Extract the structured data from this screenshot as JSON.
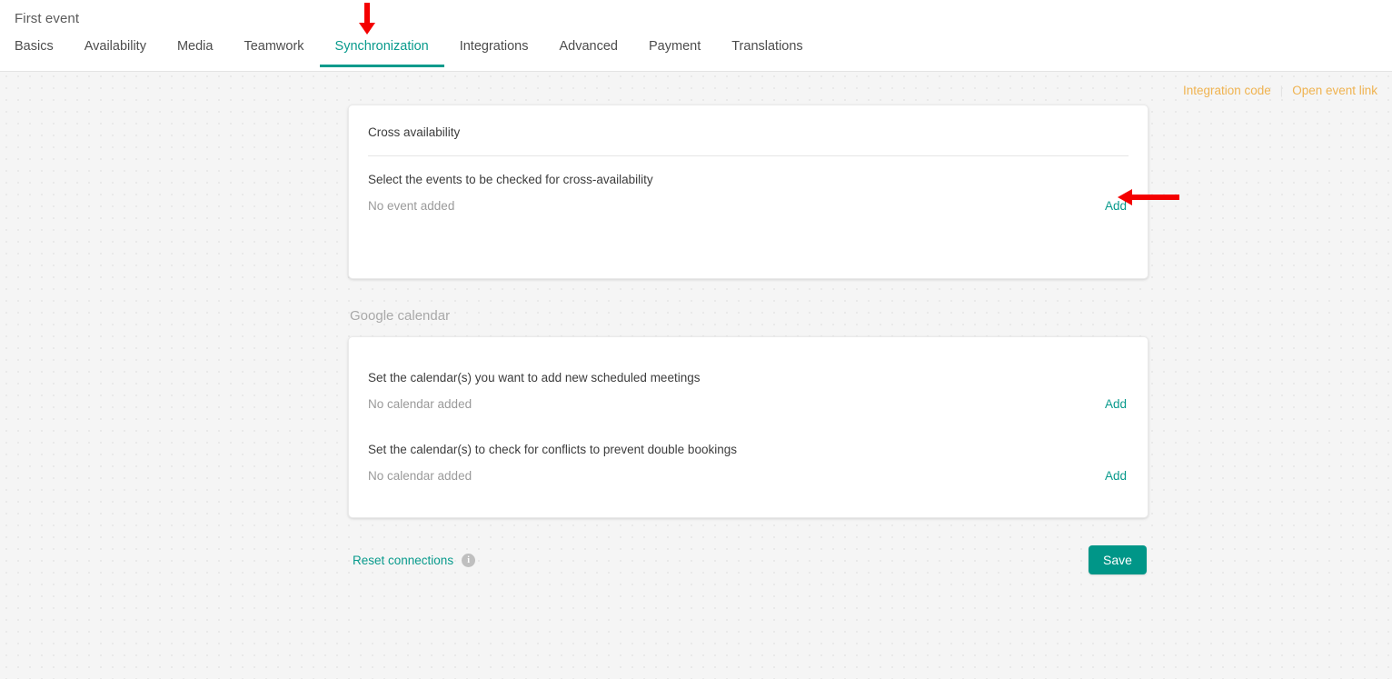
{
  "header": {
    "title": "First event",
    "tabs": [
      {
        "label": "Basics",
        "active": false
      },
      {
        "label": "Availability",
        "active": false
      },
      {
        "label": "Media",
        "active": false
      },
      {
        "label": "Teamwork",
        "active": false
      },
      {
        "label": "Synchronization",
        "active": true
      },
      {
        "label": "Integrations",
        "active": false
      },
      {
        "label": "Advanced",
        "active": false
      },
      {
        "label": "Payment",
        "active": false
      },
      {
        "label": "Translations",
        "active": false
      }
    ]
  },
  "toplinks": {
    "integration_code": "Integration code",
    "separator": "|",
    "open_event_link": "Open event link"
  },
  "cross_availability": {
    "card_title": "Cross availability",
    "field_label": "Select the events to be checked for cross-availability",
    "empty_text": "No event added",
    "add_label": "Add"
  },
  "google_calendar": {
    "section_heading": "Google calendar",
    "groups": [
      {
        "label": "Set the calendar(s) you want to add new scheduled meetings",
        "empty_text": "No calendar added",
        "add_label": "Add"
      },
      {
        "label": "Set the calendar(s) to check for conflicts to prevent double bookings",
        "empty_text": "No calendar added",
        "add_label": "Add"
      }
    ]
  },
  "footer": {
    "reset_label": "Reset connections",
    "info_icon_char": "i",
    "save_label": "Save"
  },
  "colors": {
    "accent_teal": "#009688",
    "link_teal": "#089a8c",
    "link_orange": "#f0b350",
    "annotation_red": "#f40000",
    "page_bg": "#f5f5f5"
  }
}
